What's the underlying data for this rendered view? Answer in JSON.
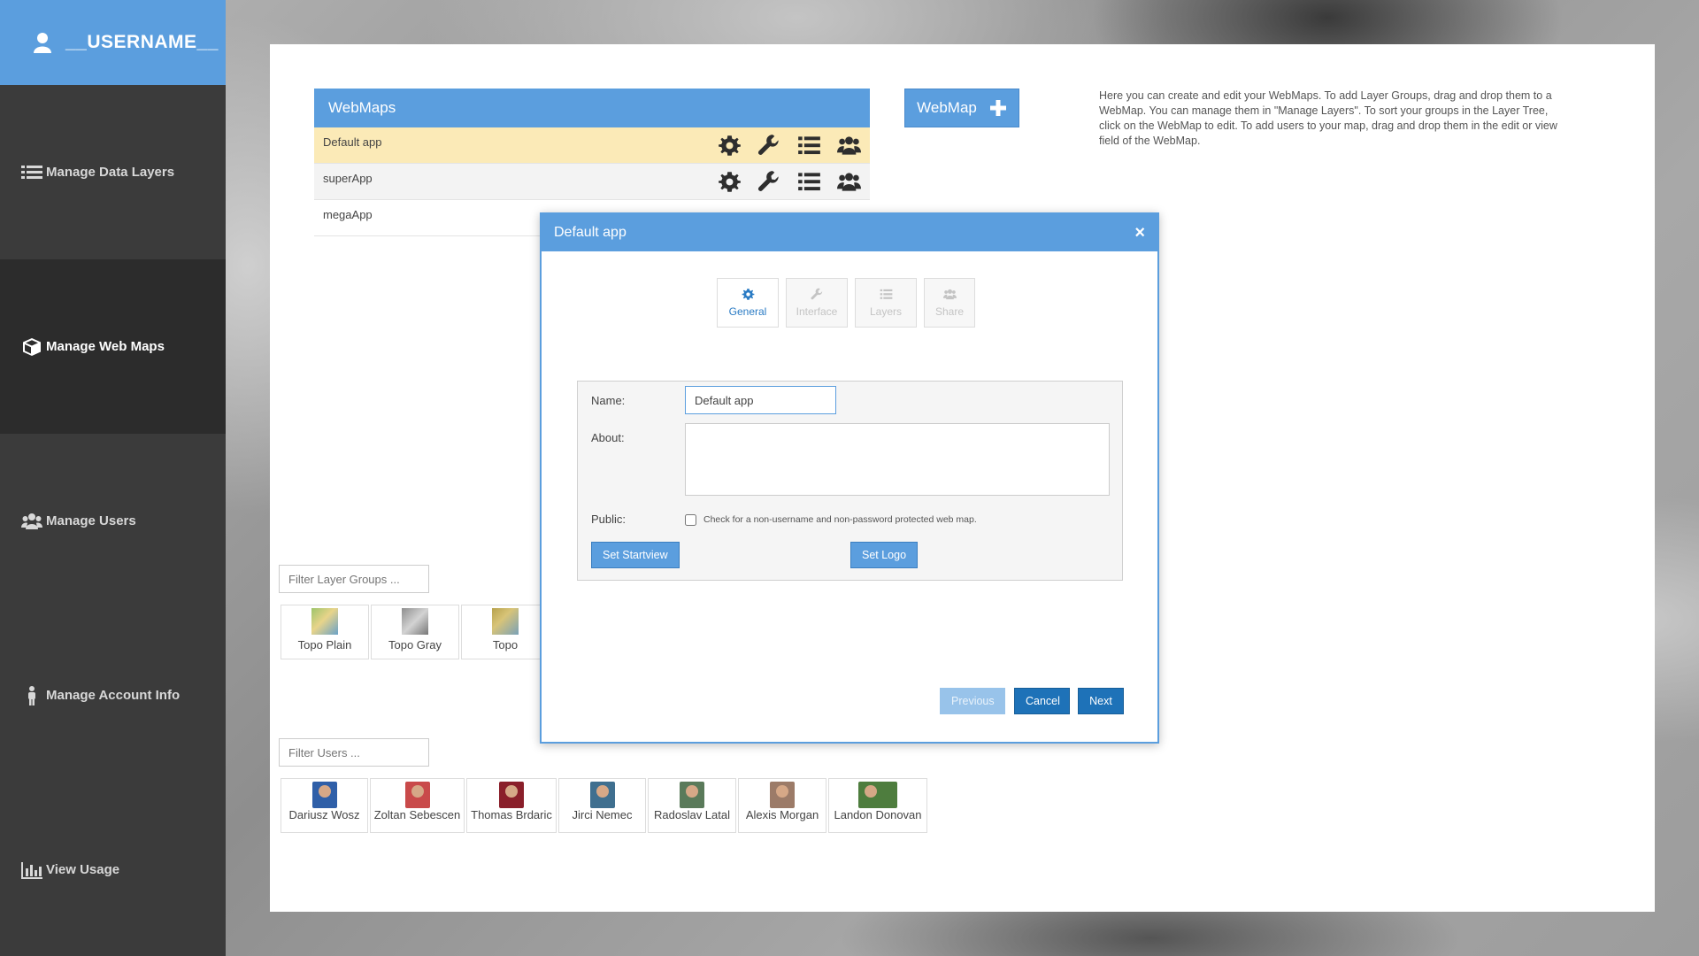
{
  "user": {
    "name": "__USERNAME__"
  },
  "nav": [
    {
      "label": "Manage Data Layers",
      "icon": "list-icon"
    },
    {
      "label": "Manage Web Maps",
      "icon": "cube-icon",
      "active": true
    },
    {
      "label": "Manage Users",
      "icon": "users-icon"
    },
    {
      "label": "Manage Account Info",
      "icon": "person-icon"
    },
    {
      "label": "View Usage",
      "icon": "bar-chart-icon"
    }
  ],
  "webmaps": {
    "title": "WebMaps",
    "rows": [
      {
        "name": "Default app",
        "selected": true
      },
      {
        "name": "superApp"
      },
      {
        "name": "megaApp"
      }
    ]
  },
  "add_webmap_label": "WebMap",
  "help_text": "Here you can create and edit your WebMaps. To add Layer Groups, drag and drop them to a WebMap. You can manage them in \"Manage Layers\". To sort your groups in the Layer Tree, click on the WebMap to edit. To add users to your map, drag and drop them in the edit or view field of the WebMap.",
  "layer_filter": {
    "placeholder": "Filter Layer Groups ..."
  },
  "layer_groups": [
    "Topo Plain",
    "Topo Gray",
    "Topo"
  ],
  "user_filter": {
    "placeholder": "Filter Users ..."
  },
  "users": [
    "Dariusz Wosz",
    "Zoltan Sebescen",
    "Thomas Brdaric",
    "Jirci Nemec",
    "Radoslav Latal",
    "Alexis Morgan",
    "Landon Donovan"
  ],
  "dialog": {
    "title": "Default app",
    "close": "×",
    "tabs": [
      "General",
      "Interface",
      "Layers",
      "Share"
    ],
    "active_tab": "General",
    "name_label": "Name:",
    "name_value": "Default app",
    "about_label": "About:",
    "public_label": "Public:",
    "public_hint": "Check for a non-username and non-password protected web map.",
    "set_startview": "Set Startview",
    "set_logo": "Set Logo",
    "previous": "Previous",
    "cancel": "Cancel",
    "next": "Next"
  },
  "colors": {
    "accent": "#5b9ede",
    "sidebar": "#3b3b3b",
    "selected_row": "#fbeab7"
  }
}
